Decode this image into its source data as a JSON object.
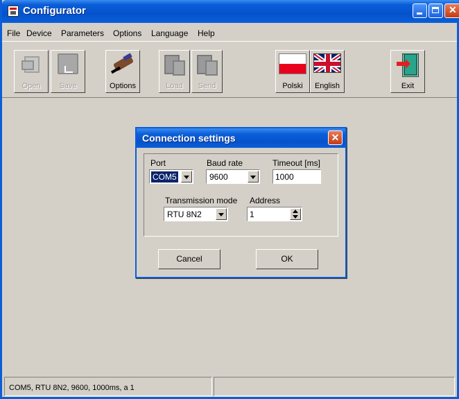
{
  "window": {
    "title": "Configurator"
  },
  "menu": [
    "File",
    "Device",
    "Parameters",
    "Options",
    "Language",
    "Help"
  ],
  "toolbar": {
    "open_label": "Open",
    "save_label": "Save",
    "options_label": "Options",
    "load_label": "Load",
    "send_label": "Send",
    "polski_label": "Polski",
    "english_label": "English",
    "exit_label": "Exit"
  },
  "dialog": {
    "title": "Connection settings",
    "port_label": "Port",
    "port_value": "COM5",
    "baud_label": "Baud rate",
    "baud_value": "9600",
    "timeout_label": "Timeout [ms]",
    "timeout_value": "1000",
    "mode_label": "Transmission mode",
    "mode_value": "RTU 8N2",
    "address_label": "Address",
    "address_value": "1",
    "cancel_label": "Cancel",
    "ok_label": "OK"
  },
  "status": {
    "text": "COM5, RTU 8N2, 9600, 1000ms, a 1"
  }
}
